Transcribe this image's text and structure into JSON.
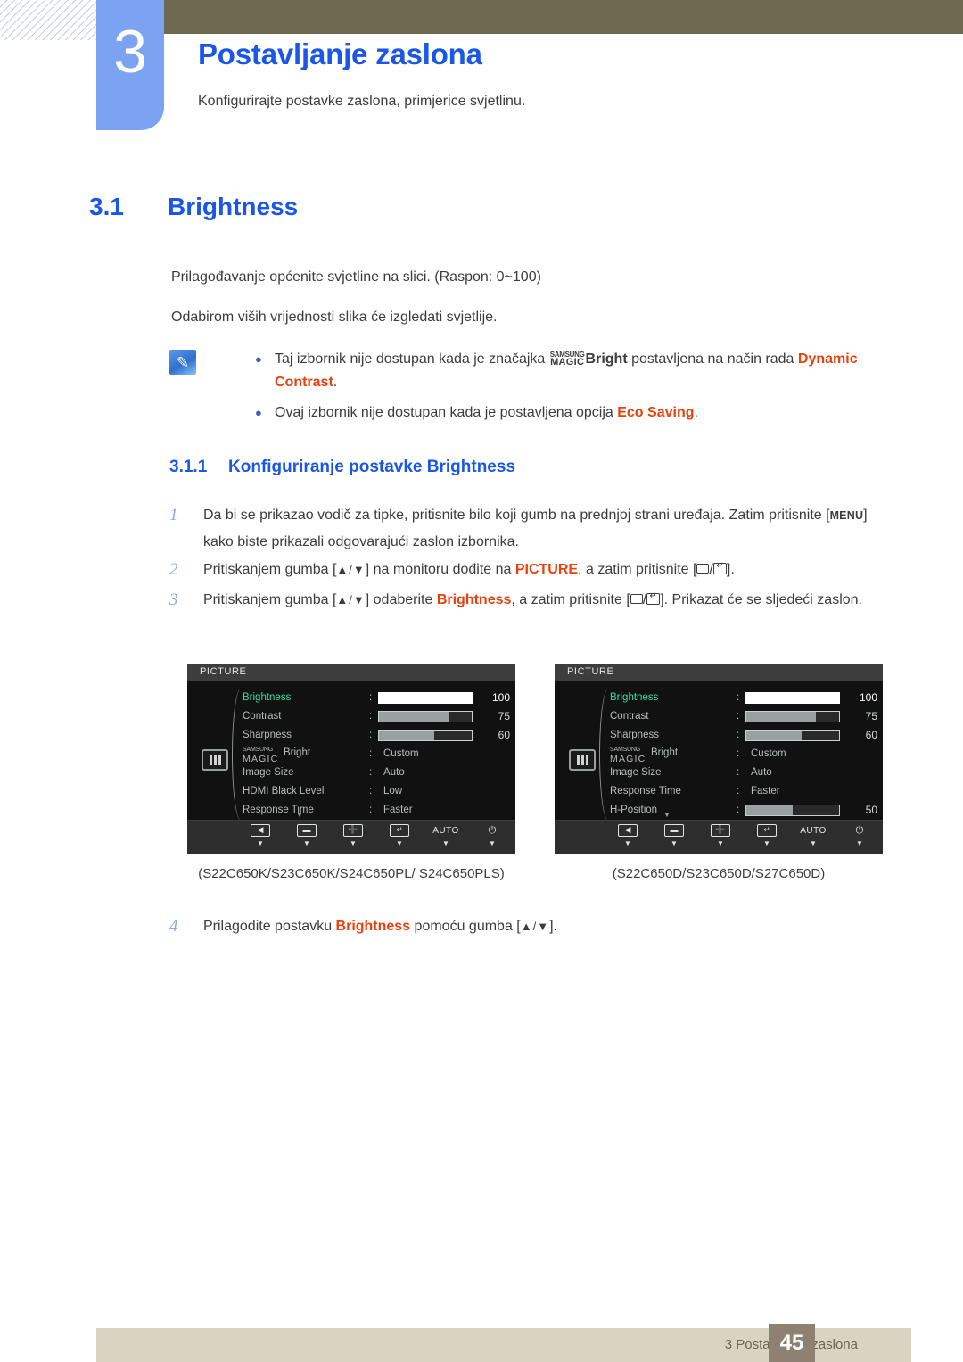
{
  "header": {
    "chapter_number": "3",
    "chapter_title": "Postavljanje zaslona",
    "chapter_subtitle": "Konfigurirajte postavke zaslona, primjerice svjetlinu."
  },
  "section": {
    "number": "3.1",
    "title": "Brightness"
  },
  "paragraphs": {
    "p1": "Prilagođavanje općenite svjetline na slici. (Raspon: 0~100)",
    "p2": "Odabirom viših vrijednosti slika će izgledati svjetlije."
  },
  "note": {
    "icon": "note-pencil-icon",
    "bullet1_pre": "Taj izbornik nije dostupan kada je značajka ",
    "bullet1_magic_top": "SAMSUNG",
    "bullet1_magic_bottom": "MAGIC",
    "bullet1_bright": "Bright",
    "bullet1_mid": " postavljena na način rada ",
    "bullet1_highlight": "Dynamic Contrast",
    "bullet1_end": ".",
    "bullet2_pre": "Ovaj izbornik nije dostupan kada je postavljena opcija ",
    "bullet2_highlight": "Eco Saving",
    "bullet2_end": "."
  },
  "subsection": {
    "number": "3.1.1",
    "title": "Konfiguriranje postavke Brightness"
  },
  "steps": [
    {
      "n": "1",
      "a": "Da bi se prikazao vodič za tipke, pritisnite bilo koji gumb na prednjoj strani uređaja. Zatim pritisnite [",
      "key": "MENU",
      "b": "] kako biste prikazali odgovarajući zaslon izbornika."
    },
    {
      "n": "2",
      "a": "Pritiskanjem gumba [",
      "ud": "▲/▼",
      "b": "] na monitoru dođite na ",
      "hl": "PICTURE",
      "c": ", a zatim pritisnite [",
      "d": "]."
    },
    {
      "n": "3",
      "a": "Pritiskanjem gumba [",
      "ud": "▲/▼",
      "b": "] odaberite ",
      "hl": "Brightness",
      "c": ", a zatim pritisnite [",
      "d": "]. Prikazat će se sljedeći zaslon."
    },
    {
      "n": "4",
      "a": "Prilagodite postavku ",
      "hl": "Brightness",
      "b": " pomoću gumba [",
      "ud": "▲/▼",
      "c": "]."
    }
  ],
  "osd_left": {
    "title": "PICTURE",
    "side_icon": "picture-bars-icon",
    "rows": [
      {
        "label": "Brightness",
        "type": "bar",
        "value": "100",
        "fill": 100,
        "selected": true
      },
      {
        "label": "Contrast",
        "type": "bar",
        "value": "75",
        "fill": 75,
        "selected": false
      },
      {
        "label": "Sharpness",
        "type": "bar",
        "value": "60",
        "fill": 60,
        "selected": false
      },
      {
        "label": "MAGIC Bright",
        "type": "magic",
        "value": "Custom",
        "selected": false
      },
      {
        "label": "Image Size",
        "type": "text",
        "value": "Auto",
        "selected": false
      },
      {
        "label": "HDMI Black Level",
        "type": "text",
        "value": "Low",
        "selected": false
      },
      {
        "label": "Response Time",
        "type": "text",
        "value": "Faster",
        "selected": false
      }
    ],
    "buttons": [
      {
        "icon": "left-arrow-icon",
        "label": "◀"
      },
      {
        "icon": "minus-icon",
        "label": "−"
      },
      {
        "icon": "plus-icon",
        "label": "+"
      },
      {
        "icon": "enter-icon",
        "label": "↵"
      },
      {
        "icon": "auto-icon",
        "label": "AUTO"
      },
      {
        "icon": "power-icon",
        "label": "⏻"
      }
    ],
    "caption": "(S22C650K/S23C650K/S24C650PL/ S24C650PLS)"
  },
  "osd_right": {
    "title": "PICTURE",
    "side_icon": "picture-bars-icon",
    "rows": [
      {
        "label": "Brightness",
        "type": "bar",
        "value": "100",
        "fill": 100,
        "selected": true
      },
      {
        "label": "Contrast",
        "type": "bar",
        "value": "75",
        "fill": 75,
        "selected": false
      },
      {
        "label": "Sharpness",
        "type": "bar",
        "value": "60",
        "fill": 60,
        "selected": false
      },
      {
        "label": "MAGIC Bright",
        "type": "magic",
        "value": "Custom",
        "selected": false
      },
      {
        "label": "Image Size",
        "type": "text",
        "value": "Auto",
        "selected": false
      },
      {
        "label": "Response Time",
        "type": "text",
        "value": "Faster",
        "selected": false
      },
      {
        "label": "H-Position",
        "type": "bar",
        "value": "50",
        "fill": 50,
        "selected": false
      }
    ],
    "buttons": [
      {
        "icon": "left-arrow-icon",
        "label": "◀"
      },
      {
        "icon": "minus-icon",
        "label": "−"
      },
      {
        "icon": "plus-icon",
        "label": "+"
      },
      {
        "icon": "enter-icon",
        "label": "↵"
      },
      {
        "icon": "auto-icon",
        "label": "AUTO"
      },
      {
        "icon": "power-icon",
        "label": "⏻"
      }
    ],
    "caption": "(S22C650D/S23C650D/S27C650D)"
  },
  "magic_label": {
    "top": "SAMSUNG",
    "bottom": "MAGIC",
    "word": "Bright"
  },
  "footer": {
    "text": "3 Postavljanje zaslona",
    "page": "45"
  },
  "colors": {
    "accent_blue": "#1a56e8",
    "tab_blue": "#7ba3f2",
    "olive": "#6e6a50",
    "orange": "#e8410d",
    "osd_green": "#2fe2a0",
    "footer_beige": "#d9d3c2",
    "footer_brown": "#8e8173"
  }
}
